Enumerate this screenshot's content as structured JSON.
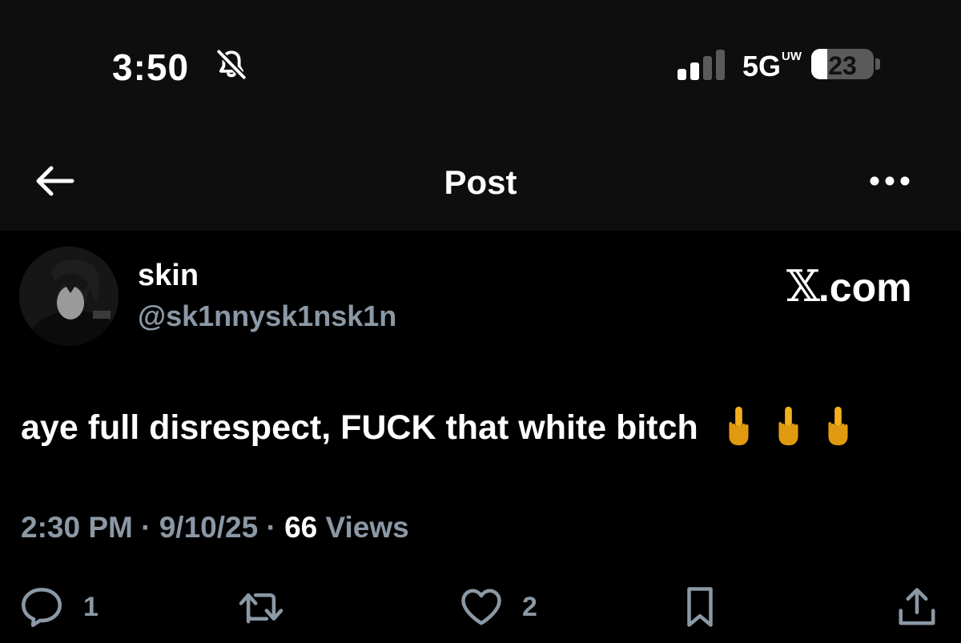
{
  "status_bar": {
    "time": "3:50",
    "network": "5G",
    "network_sup": "UW",
    "battery": "23"
  },
  "nav": {
    "title": "Post"
  },
  "post": {
    "display_name": "skin",
    "handle": "@sk1nnysk1nsk1n",
    "brand": "X.com",
    "text": "aye full disrespect, FUCK that white bitch",
    "emoji": "🖕🖕🖕",
    "time": "2:30 PM",
    "date": "9/10/25",
    "views_count": "66",
    "views_label": "Views",
    "separator": "·"
  },
  "actions": {
    "replies": "1",
    "likes": "2"
  },
  "colors": {
    "background": "#000000",
    "header": "#0e0e0e",
    "muted": "#8b98a5",
    "text": "#ffffff",
    "emoji": "#f2b020"
  }
}
